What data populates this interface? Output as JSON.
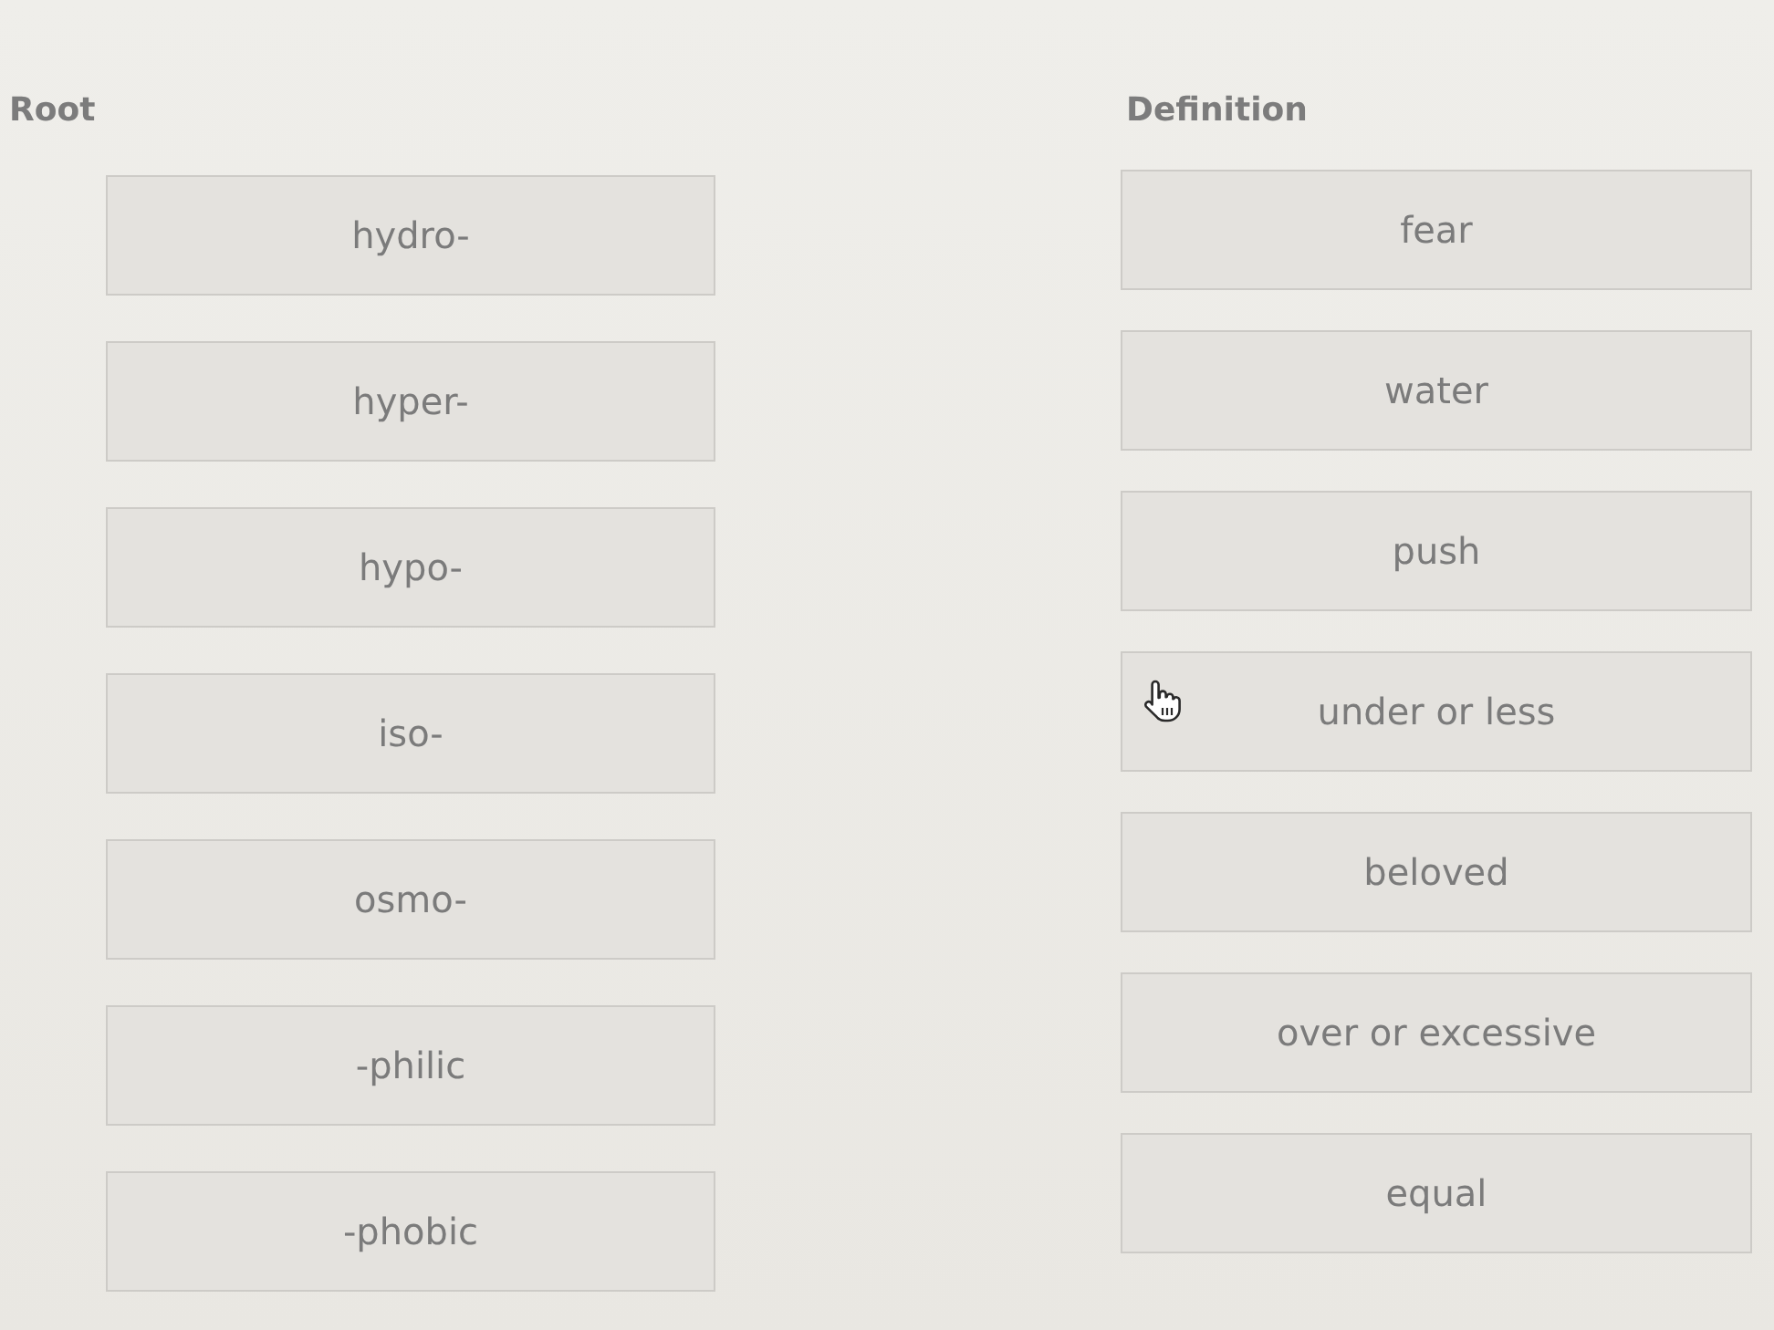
{
  "columns": [
    {
      "heading": "Root",
      "items": [
        "hydro-",
        "hyper-",
        "hypo-",
        "iso-",
        "osmo-",
        "-philic",
        "-phobic"
      ]
    },
    {
      "heading": "Definition",
      "items": [
        "fear",
        "water",
        "push",
        "under or less",
        "beloved",
        "over or excessive",
        "equal"
      ]
    }
  ]
}
